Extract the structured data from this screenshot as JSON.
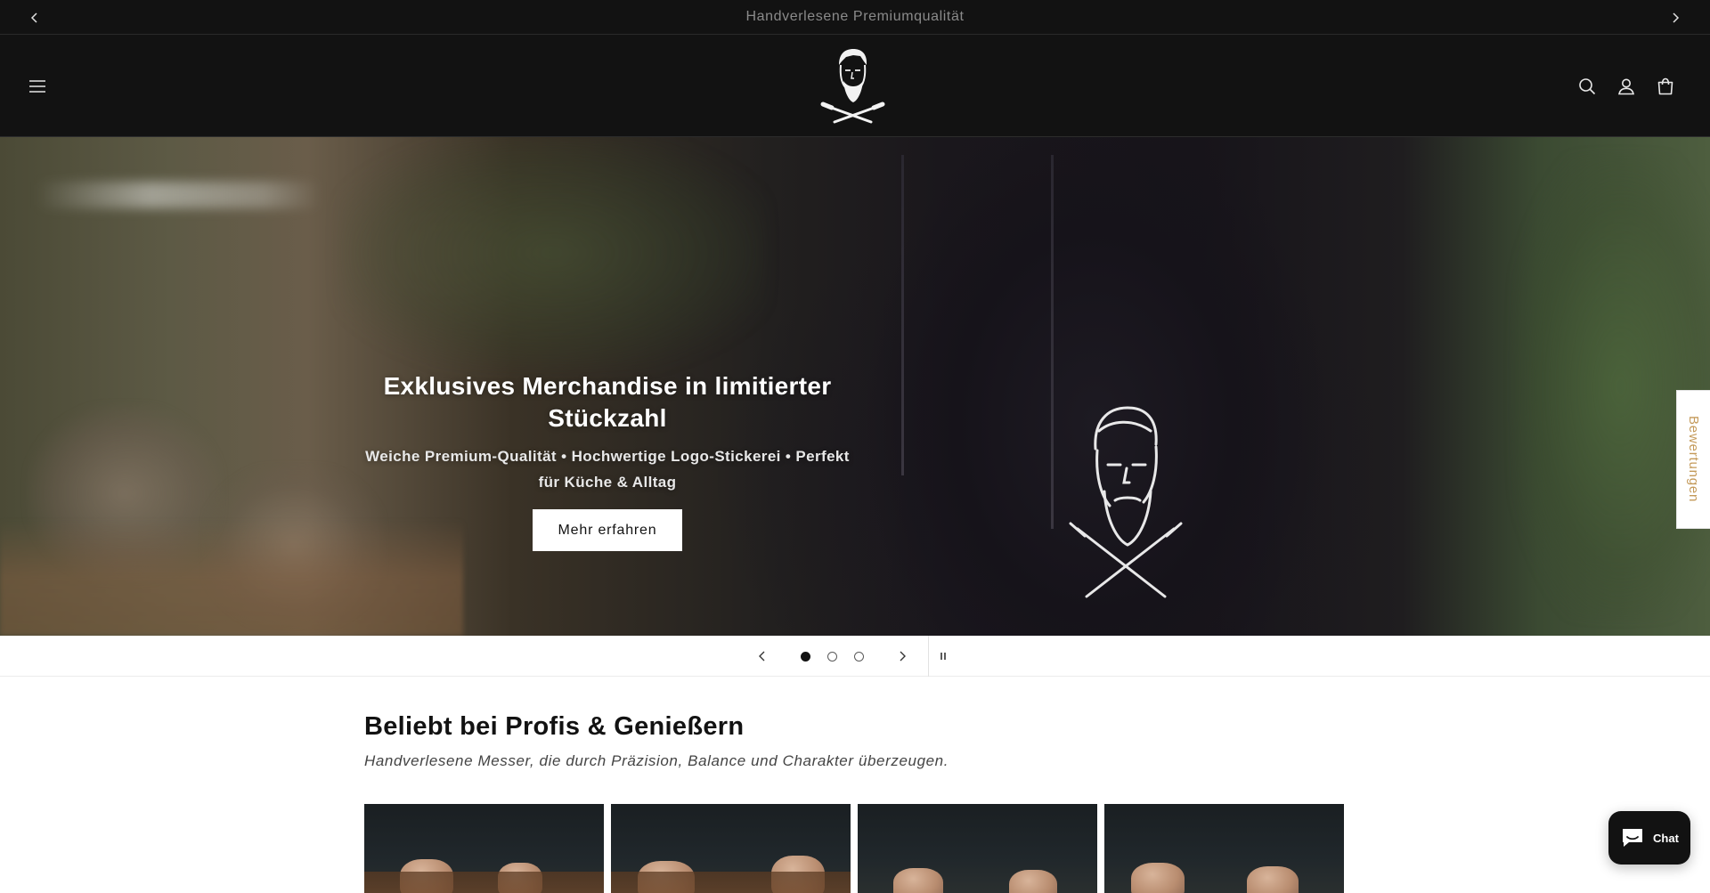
{
  "announcement": {
    "text": "Handverlesene Premiumqualität",
    "prev_icon": "chevron-left-icon",
    "next_icon": "chevron-right-icon"
  },
  "header": {
    "menu_icon": "hamburger-menu-icon",
    "logo_icon": "bearded-chef-crossed-knives-logo",
    "icons": [
      "search-icon",
      "account-icon",
      "cart-icon"
    ]
  },
  "hero": {
    "title": "Exklusives Merchandise in limitierter Stückzahl",
    "subtitle": "Weiche Premium-Qualität • Hochwertige Logo-Stickerei • Perfekt für Küche & Alltag",
    "button_label": "Mehr erfahren"
  },
  "reviews_tab": {
    "label": "Bewertungen"
  },
  "slider": {
    "slide_count": 3,
    "active_slide": 1,
    "prev_icon": "chevron-left-icon",
    "next_icon": "chevron-right-icon",
    "pause_icon": "pause-icon"
  },
  "featured": {
    "title": "Beliebt bei Profis & Genießern",
    "subtitle": "Handverlesene Messer, die durch Präzision, Balance und Charakter überzeugen.",
    "product_count_visible": 4
  },
  "chat": {
    "label": "Chat",
    "icon": "chat-bubble-icon"
  },
  "colors": {
    "header_bg": "#121212",
    "reviews_text": "#c49a5a",
    "button_bg": "#ffffff"
  }
}
